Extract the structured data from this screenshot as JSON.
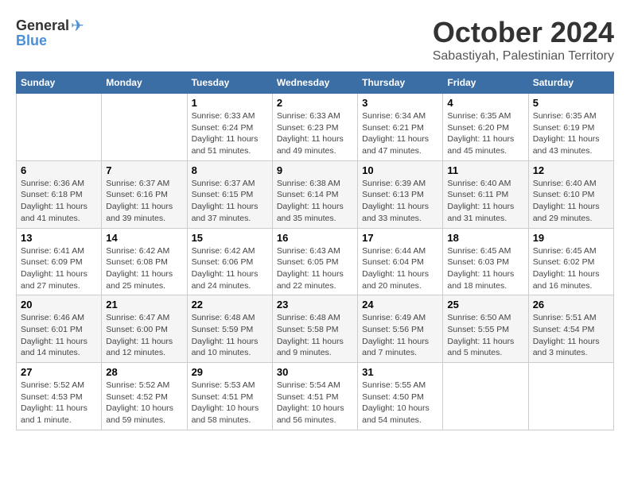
{
  "logo": {
    "general": "General",
    "blue": "Blue",
    "bird_unicode": "🐦"
  },
  "title": {
    "month_year": "October 2024",
    "location": "Sabastiyah, Palestinian Territory"
  },
  "weekdays": [
    "Sunday",
    "Monday",
    "Tuesday",
    "Wednesday",
    "Thursday",
    "Friday",
    "Saturday"
  ],
  "weeks": [
    [
      {
        "day": "",
        "info": ""
      },
      {
        "day": "",
        "info": ""
      },
      {
        "day": "1",
        "info": "Sunrise: 6:33 AM\nSunset: 6:24 PM\nDaylight: 11 hours and 51 minutes."
      },
      {
        "day": "2",
        "info": "Sunrise: 6:33 AM\nSunset: 6:23 PM\nDaylight: 11 hours and 49 minutes."
      },
      {
        "day": "3",
        "info": "Sunrise: 6:34 AM\nSunset: 6:21 PM\nDaylight: 11 hours and 47 minutes."
      },
      {
        "day": "4",
        "info": "Sunrise: 6:35 AM\nSunset: 6:20 PM\nDaylight: 11 hours and 45 minutes."
      },
      {
        "day": "5",
        "info": "Sunrise: 6:35 AM\nSunset: 6:19 PM\nDaylight: 11 hours and 43 minutes."
      }
    ],
    [
      {
        "day": "6",
        "info": "Sunrise: 6:36 AM\nSunset: 6:18 PM\nDaylight: 11 hours and 41 minutes."
      },
      {
        "day": "7",
        "info": "Sunrise: 6:37 AM\nSunset: 6:16 PM\nDaylight: 11 hours and 39 minutes."
      },
      {
        "day": "8",
        "info": "Sunrise: 6:37 AM\nSunset: 6:15 PM\nDaylight: 11 hours and 37 minutes."
      },
      {
        "day": "9",
        "info": "Sunrise: 6:38 AM\nSunset: 6:14 PM\nDaylight: 11 hours and 35 minutes."
      },
      {
        "day": "10",
        "info": "Sunrise: 6:39 AM\nSunset: 6:13 PM\nDaylight: 11 hours and 33 minutes."
      },
      {
        "day": "11",
        "info": "Sunrise: 6:40 AM\nSunset: 6:11 PM\nDaylight: 11 hours and 31 minutes."
      },
      {
        "day": "12",
        "info": "Sunrise: 6:40 AM\nSunset: 6:10 PM\nDaylight: 11 hours and 29 minutes."
      }
    ],
    [
      {
        "day": "13",
        "info": "Sunrise: 6:41 AM\nSunset: 6:09 PM\nDaylight: 11 hours and 27 minutes."
      },
      {
        "day": "14",
        "info": "Sunrise: 6:42 AM\nSunset: 6:08 PM\nDaylight: 11 hours and 25 minutes."
      },
      {
        "day": "15",
        "info": "Sunrise: 6:42 AM\nSunset: 6:06 PM\nDaylight: 11 hours and 24 minutes."
      },
      {
        "day": "16",
        "info": "Sunrise: 6:43 AM\nSunset: 6:05 PM\nDaylight: 11 hours and 22 minutes."
      },
      {
        "day": "17",
        "info": "Sunrise: 6:44 AM\nSunset: 6:04 PM\nDaylight: 11 hours and 20 minutes."
      },
      {
        "day": "18",
        "info": "Sunrise: 6:45 AM\nSunset: 6:03 PM\nDaylight: 11 hours and 18 minutes."
      },
      {
        "day": "19",
        "info": "Sunrise: 6:45 AM\nSunset: 6:02 PM\nDaylight: 11 hours and 16 minutes."
      }
    ],
    [
      {
        "day": "20",
        "info": "Sunrise: 6:46 AM\nSunset: 6:01 PM\nDaylight: 11 hours and 14 minutes."
      },
      {
        "day": "21",
        "info": "Sunrise: 6:47 AM\nSunset: 6:00 PM\nDaylight: 11 hours and 12 minutes."
      },
      {
        "day": "22",
        "info": "Sunrise: 6:48 AM\nSunset: 5:59 PM\nDaylight: 11 hours and 10 minutes."
      },
      {
        "day": "23",
        "info": "Sunrise: 6:48 AM\nSunset: 5:58 PM\nDaylight: 11 hours and 9 minutes."
      },
      {
        "day": "24",
        "info": "Sunrise: 6:49 AM\nSunset: 5:56 PM\nDaylight: 11 hours and 7 minutes."
      },
      {
        "day": "25",
        "info": "Sunrise: 6:50 AM\nSunset: 5:55 PM\nDaylight: 11 hours and 5 minutes."
      },
      {
        "day": "26",
        "info": "Sunrise: 5:51 AM\nSunset: 4:54 PM\nDaylight: 11 hours and 3 minutes."
      }
    ],
    [
      {
        "day": "27",
        "info": "Sunrise: 5:52 AM\nSunset: 4:53 PM\nDaylight: 11 hours and 1 minute."
      },
      {
        "day": "28",
        "info": "Sunrise: 5:52 AM\nSunset: 4:52 PM\nDaylight: 10 hours and 59 minutes."
      },
      {
        "day": "29",
        "info": "Sunrise: 5:53 AM\nSunset: 4:51 PM\nDaylight: 10 hours and 58 minutes."
      },
      {
        "day": "30",
        "info": "Sunrise: 5:54 AM\nSunset: 4:51 PM\nDaylight: 10 hours and 56 minutes."
      },
      {
        "day": "31",
        "info": "Sunrise: 5:55 AM\nSunset: 4:50 PM\nDaylight: 10 hours and 54 minutes."
      },
      {
        "day": "",
        "info": ""
      },
      {
        "day": "",
        "info": ""
      }
    ]
  ]
}
